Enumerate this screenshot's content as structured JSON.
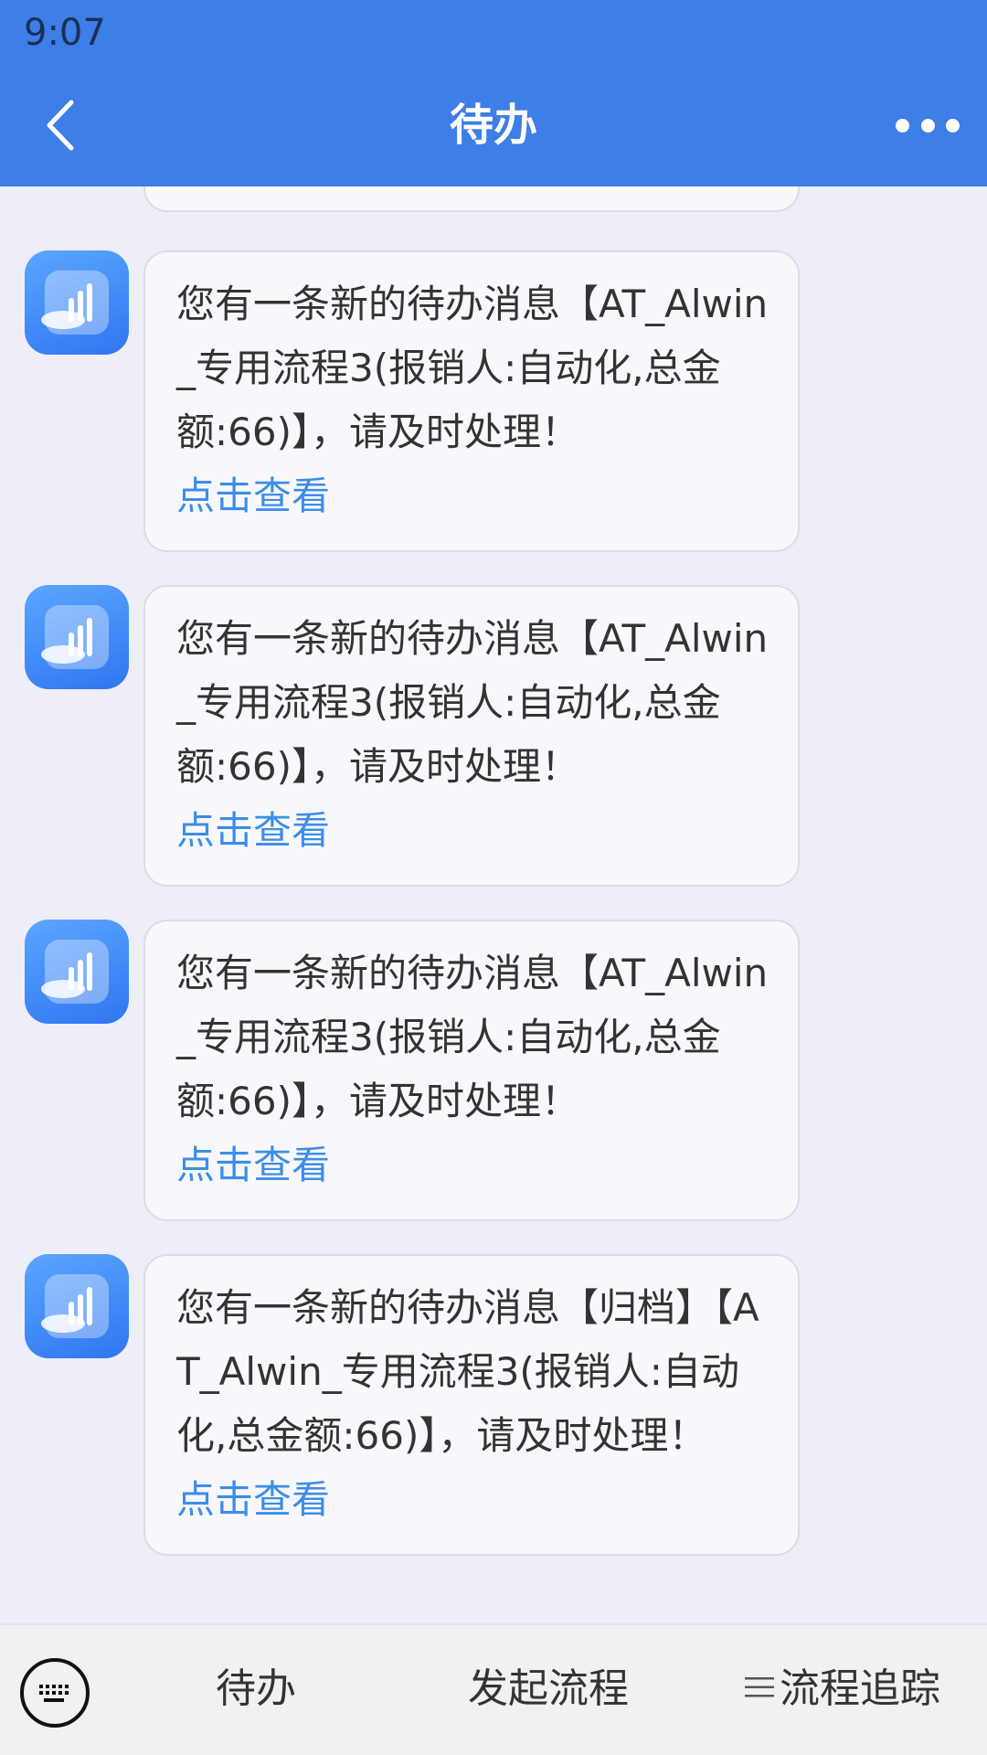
{
  "status_bar": {
    "time": "9:07"
  },
  "header": {
    "title": "待办"
  },
  "messages": [
    {
      "text": "您有一条新的待办消息【AT_Alwin_专用流程3(报销人:自动化,总金额:66)】，请及时处理！",
      "link": "点击查看"
    },
    {
      "text": "您有一条新的待办消息【AT_Alwin_专用流程3(报销人:自动化,总金额:66)】，请及时处理！",
      "link": "点击查看"
    },
    {
      "text": "您有一条新的待办消息【AT_Alwin_专用流程3(报销人:自动化,总金额:66)】，请及时处理！",
      "link": "点击查看"
    },
    {
      "text": "您有一条新的待办消息【归档】【AT_Alwin_专用流程3(报销人:自动化,总金额:66)】，请及时处理！",
      "link": "点击查看"
    }
  ],
  "bottom_bar": {
    "tabs": [
      {
        "label": "待办"
      },
      {
        "label": "发起流程"
      },
      {
        "label": "流程追踪"
      }
    ]
  },
  "icons": {
    "back": "chevron-left-icon",
    "more": "more-dots-icon",
    "avatar": "app-chart-icon",
    "keyboard": "keyboard-icon",
    "menu": "menu-lines-icon"
  },
  "colors": {
    "brand": "#3d7fe6",
    "link": "#3c8ee8",
    "background": "#eeeef8"
  }
}
